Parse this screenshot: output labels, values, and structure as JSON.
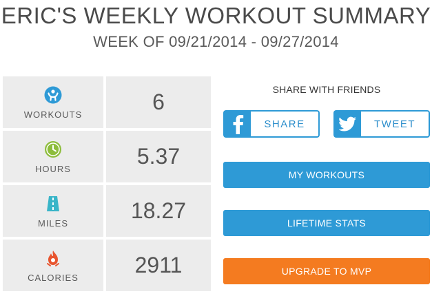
{
  "header": {
    "title": "ERIC'S WEEKLY WORKOUT SUMMARY",
    "subtitle": "WEEK OF 09/21/2014 - 09/27/2014"
  },
  "stats": [
    {
      "label": "WORKOUTS",
      "value": "6",
      "icon": "person-icon",
      "icon_color": "#2e9ad6"
    },
    {
      "label": "HOURS",
      "value": "5.37",
      "icon": "clock-icon",
      "icon_color": "#8dbd3c"
    },
    {
      "label": "MILES",
      "value": "18.27",
      "icon": "road-icon",
      "icon_color": "#39b5c8"
    },
    {
      "label": "CALORIES",
      "value": "2911",
      "icon": "flame-icon",
      "icon_color": "#e8552f"
    }
  ],
  "share": {
    "title": "SHARE WITH FRIENDS",
    "facebook_label": "SHARE",
    "twitter_label": "TWEET"
  },
  "actions": {
    "my_workouts": "MY WORKOUTS",
    "lifetime_stats": "LIFETIME STATS",
    "upgrade": "UPGRADE TO MVP"
  },
  "colors": {
    "accent_blue": "#2e9ad6",
    "upgrade_orange": "#f47b20",
    "cell_gray": "#ececec"
  }
}
